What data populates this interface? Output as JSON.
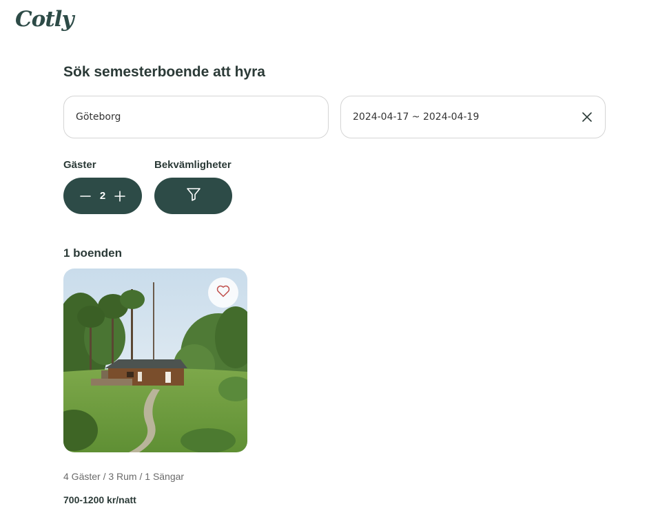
{
  "header": {
    "logo_text": "Cotly"
  },
  "search": {
    "title": "Sök semesterboende att hyra",
    "location_value": "Göteborg",
    "dates_value": "2024-04-17 ~ 2024-04-19"
  },
  "filters": {
    "guests_label": "Gäster",
    "guests_count": "2",
    "amenities_label": "Bekvämligheter"
  },
  "results": {
    "count_text": "1 boenden",
    "listings": [
      {
        "specs": "4 Gäster / 3 Rum / 1 Sängar",
        "price": "700-1200 kr/natt"
      }
    ]
  },
  "colors": {
    "brand": "#2d4b47",
    "heart": "#c0504d"
  },
  "icons": [
    "close-icon",
    "minus-icon",
    "plus-icon",
    "filter-funnel-icon",
    "heart-icon"
  ]
}
